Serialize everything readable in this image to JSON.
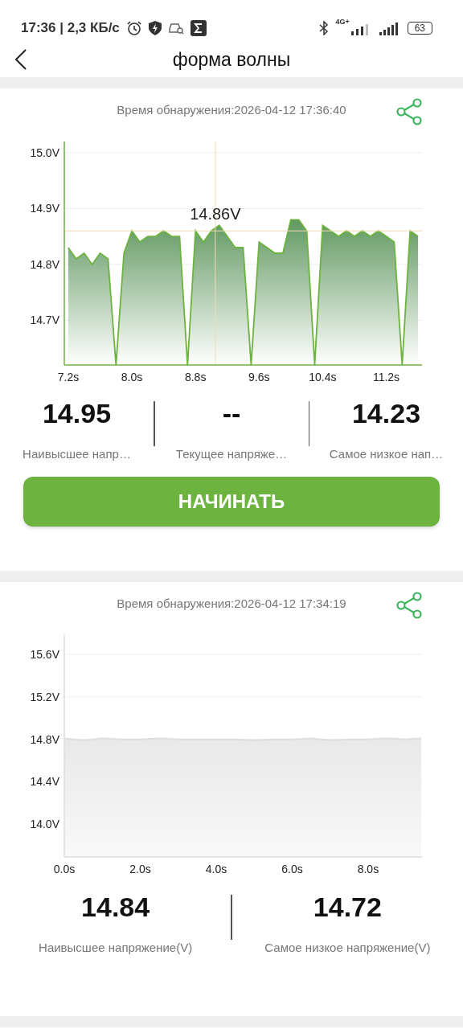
{
  "status_bar": {
    "time": "17:36 | 2,3 КБ/с",
    "network": "4G+",
    "battery": "63"
  },
  "header": {
    "title": "форма волны"
  },
  "records": [
    {
      "detected": "Время обнаружения:2026-04-12 17:36:40",
      "chart_data": {
        "type": "area",
        "xlim": [
          7.15,
          11.65
        ],
        "ylim": [
          14.62,
          15.02
        ],
        "xticks": [
          {
            "value": 7.2,
            "label": "7.2s"
          },
          {
            "value": 8.0,
            "label": "8.0s"
          },
          {
            "value": 8.8,
            "label": "8.8s"
          },
          {
            "value": 9.6,
            "label": "9.6s"
          },
          {
            "value": 10.4,
            "label": "10.4s"
          },
          {
            "value": 11.2,
            "label": "11.2s"
          }
        ],
        "yticks": [
          {
            "value": 14.7,
            "label": "14.7V"
          },
          {
            "value": 14.8,
            "label": "14.8V"
          },
          {
            "value": 14.9,
            "label": "14.9V"
          },
          {
            "value": 15.0,
            "label": "15.0V"
          }
        ],
        "x": [
          7.2,
          7.3,
          7.4,
          7.5,
          7.6,
          7.7,
          7.8,
          7.9,
          8.0,
          8.1,
          8.2,
          8.3,
          8.4,
          8.5,
          8.6,
          8.7,
          8.8,
          8.9,
          9.0,
          9.1,
          9.2,
          9.3,
          9.4,
          9.5,
          9.6,
          9.7,
          9.8,
          9.9,
          10.0,
          10.1,
          10.2,
          10.3,
          10.4,
          10.5,
          10.6,
          10.7,
          10.8,
          10.9,
          11.0,
          11.1,
          11.2,
          11.3,
          11.4,
          11.5,
          11.6
        ],
        "series": [
          {
            "color": "#6db33f",
            "values": [
              14.83,
              14.81,
              14.82,
              14.8,
              14.82,
              14.81,
              null,
              14.82,
              14.86,
              14.84,
              14.85,
              14.85,
              14.86,
              14.85,
              14.85,
              null,
              14.86,
              14.84,
              14.86,
              14.87,
              14.85,
              14.83,
              14.83,
              null,
              14.84,
              14.83,
              14.82,
              14.82,
              14.88,
              14.88,
              14.86,
              null,
              14.87,
              14.86,
              14.85,
              14.86,
              14.85,
              14.86,
              14.85,
              14.86,
              14.85,
              14.84,
              null,
              14.86,
              14.85
            ]
          }
        ],
        "grid": true,
        "ref_lines": [
          {
            "axis": "y",
            "value": 14.86
          },
          {
            "axis": "x",
            "value": 9.05
          }
        ],
        "annotations": [
          {
            "x": 9.05,
            "y": 14.86,
            "text": "14.86V"
          }
        ]
      },
      "stats": [
        {
          "value": "14.95",
          "label": "Наивысшее напр…"
        },
        {
          "value": "--",
          "label": "Текущее напряже…"
        },
        {
          "value": "14.23",
          "label": "Самое низкое нап…"
        }
      ],
      "button": "НАЧИНАТЬ"
    },
    {
      "detected": "Время обнаружения:2026-04-12 17:34:19",
      "chart_data": {
        "type": "area",
        "xlim": [
          0,
          9.42
        ],
        "ylim": [
          13.69,
          15.79
        ],
        "xticks": [
          {
            "value": 0,
            "label": "0.0s"
          },
          {
            "value": 2,
            "label": "2.0s"
          },
          {
            "value": 4,
            "label": "4.0s"
          },
          {
            "value": 6,
            "label": "6.0s"
          },
          {
            "value": 8,
            "label": "8.0s"
          }
        ],
        "yticks": [
          {
            "value": 14.0,
            "label": "14.0V"
          },
          {
            "value": 14.4,
            "label": "14.4V"
          },
          {
            "value": 14.8,
            "label": "14.8V"
          },
          {
            "value": 15.2,
            "label": "15.2V"
          },
          {
            "value": 15.6,
            "label": "15.6V"
          }
        ],
        "x": [
          0,
          0.5,
          1,
          1.5,
          2,
          2.5,
          3,
          3.5,
          4,
          4.5,
          5,
          5.5,
          6,
          6.5,
          7,
          7.5,
          8,
          8.5,
          9,
          9.4
        ],
        "grid": true,
        "series": [
          {
            "color": "#dddddd",
            "values": [
              14.81,
              14.79,
              14.81,
              14.8,
              14.8,
              14.81,
              14.8,
              14.8,
              14.8,
              14.8,
              14.79,
              14.8,
              14.8,
              14.81,
              14.79,
              14.8,
              14.8,
              14.81,
              14.8,
              14.81
            ]
          }
        ]
      },
      "stats": [
        {
          "value": "14.84",
          "label": "Наивысшее напряжение(V)"
        },
        {
          "value": "14.72",
          "label": "Самое низкое напряжение(V)"
        }
      ]
    }
  ]
}
